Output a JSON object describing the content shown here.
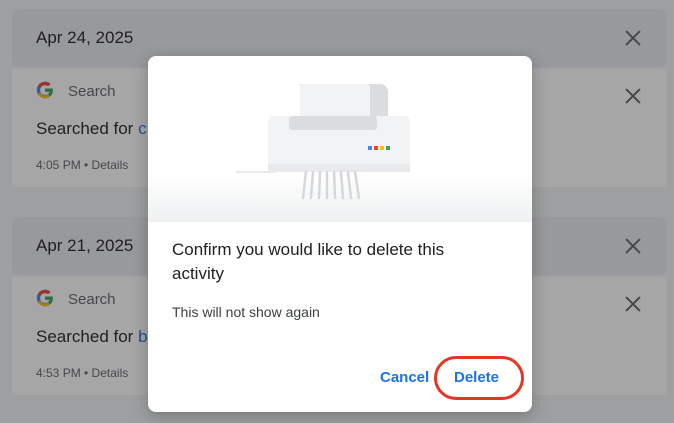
{
  "feed": {
    "groups": [
      {
        "date": "Apr 24, 2025",
        "activity": {
          "product": "Search",
          "prefix": "Searched for",
          "query": "c",
          "time": "4:05 PM • Details"
        }
      },
      {
        "date": "Apr 21, 2025",
        "activity": {
          "product": "Search",
          "prefix": "Searched for",
          "query": "b",
          "time": "4:53 PM • Details"
        }
      }
    ]
  },
  "dialog": {
    "title": "Confirm you would like to delete this activity",
    "body": "This will not show again",
    "cancel_label": "Cancel",
    "delete_label": "Delete"
  },
  "colors": {
    "accent": "#1a73e8",
    "highlight_ring": "#e53525",
    "google_blue": "#4285f4",
    "google_red": "#ea4335",
    "google_yellow": "#fbbc05",
    "google_green": "#34a853"
  },
  "icons": [
    "google-logo-icon",
    "close-icon",
    "shredder-illustration"
  ]
}
